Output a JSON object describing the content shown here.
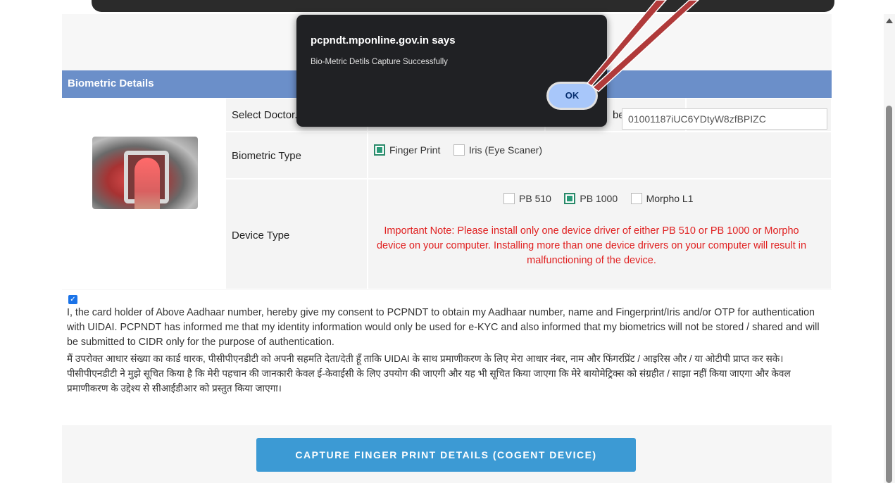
{
  "panel": {
    "title": "Biometric Details"
  },
  "fields": {
    "select_doctor_label": "Select Doctor.",
    "aadhaar_label_partial": "ber",
    "aadhaar_value": "01001187iUC6YDtyW8zfBPIZC",
    "biometric_type_label": "Biometric Type",
    "device_type_label": "Device Type"
  },
  "biometric_options": [
    {
      "label": "Finger Print",
      "checked": true
    },
    {
      "label": "Iris (Eye Scaner)",
      "checked": false
    }
  ],
  "device_options": [
    {
      "label": "PB 510",
      "checked": false
    },
    {
      "label": "PB 1000",
      "checked": true
    },
    {
      "label": "Morpho L1",
      "checked": false
    }
  ],
  "device_note": "Important Note: Please install only one device driver of either PB 510 or PB 1000 or Morpho device on your computer. Installing more than one device drivers on your computer will result in malfunctioning of the device.",
  "consent": {
    "checked": true,
    "english": "I, the card holder of Above Aadhaar number, hereby give my consent to PCPNDT to obtain my Aadhaar number, name and Fingerprint/Iris and/or OTP for authentication with UIDAI. PCPNDT has informed me that my identity information would only be used for e-KYC and also informed that my biometrics will not be stored / shared and will be submitted to CIDR only for the purpose of authentication.",
    "hindi": "मैं उपरोक्त आधार संख्या का कार्ड धारक, पीसीपीएनडीटी को अपनी सहमति देता/देती हूँ ताकि UIDAI के साथ प्रमाणीकरण के लिए मेरा आधार नंबर, नाम और फिंगरप्रिंट / आइरिस और / या ओटीपी प्राप्त कर सके। पीसीपीएनडीटी ने मुझे सूचित किया है कि मेरी पहचान की जानकारी केवल ई-केवाईसी के लिए उपयोग की जाएगी और यह भी सूचित किया जाएगा कि मेरे बायोमेट्रिक्स को संग्रहीत / साझा नहीं किया जाएगा और केवल प्रमाणीकरण के उद्देश्य से सीआईडीआर को प्रस्तुत किया जाएगा।"
  },
  "capture_button": "CAPTURE FINGER PRINT DETAILS (COGENT DEVICE)",
  "dialog": {
    "title": "pcpndt.mponline.gov.in says",
    "message": "Bio-Metric Detils Capture Successfully",
    "ok_label": "OK"
  },
  "colors": {
    "header_bg": "#6b8fc9",
    "note_red": "#e02020",
    "button_blue": "#3c9ad4",
    "dialog_bg": "#202124",
    "ok_bg": "#a8c7fa",
    "annotation_arrow": "#b03a3a"
  }
}
